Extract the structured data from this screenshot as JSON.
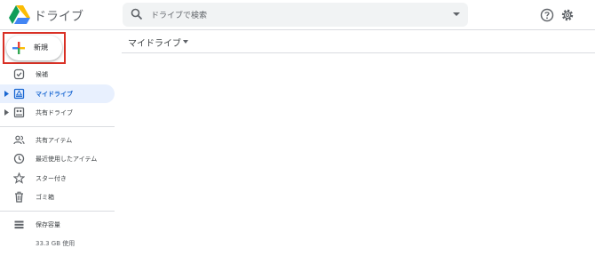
{
  "header": {
    "app_title": "ドライブ",
    "search": {
      "placeholder": "ドライブで検索"
    },
    "icons": [
      "drive-logo-icon",
      "search-icon",
      "search-options-icon",
      "help-icon",
      "gear-icon"
    ]
  },
  "sidebar": {
    "new_label": "新規",
    "items": [
      {
        "label": "候補",
        "icon": "priority-icon"
      },
      {
        "label": "マイドライブ",
        "icon": "my-drive-icon",
        "active": true
      },
      {
        "label": "共有ドライブ",
        "icon": "shared-drives-icon"
      },
      {
        "label": "共有アイテム",
        "icon": "people-icon"
      },
      {
        "label": "最近使用したアイテム",
        "icon": "clock-icon"
      },
      {
        "label": "スター付き",
        "icon": "star-icon"
      },
      {
        "label": "ゴミ箱",
        "icon": "trash-icon"
      },
      {
        "label": "保存容量",
        "icon": "storage-icon"
      }
    ],
    "storage_used": "33.3 GB 使用"
  },
  "main": {
    "title": "マイドライブ"
  },
  "colors": {
    "highlight_border": "#d93025",
    "active_bg": "#e8f0fe",
    "active_text": "#1967d2"
  }
}
